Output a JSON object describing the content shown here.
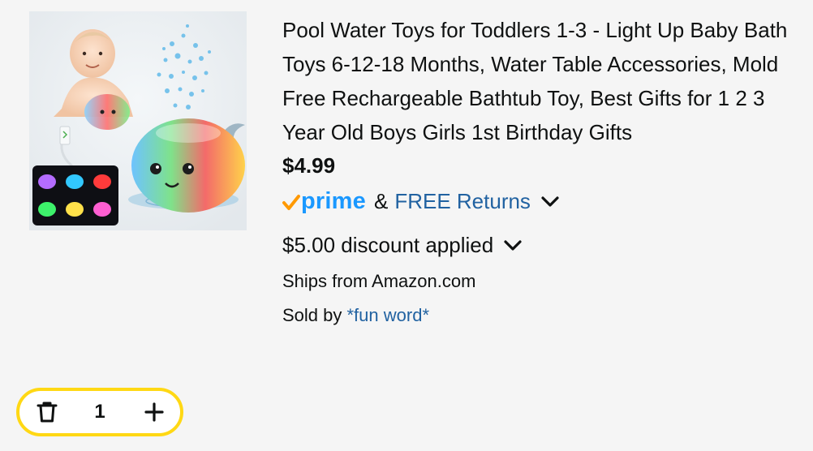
{
  "product": {
    "image_alt": "whale bath toy",
    "title": "Pool Water Toys for Toddlers 1-3 - Light Up Baby Bath Toys 6-12-18 Months, Water Table Accessories, Mold Free Rechargeable Bathtub Toy, Best Gifts for 1 2 3 Year Old Boys Girls 1st Birthday Gifts",
    "price": "$4.99",
    "prime_label": "prime",
    "ampersand": "&",
    "returns_label": "FREE Returns",
    "discount_label": "$5.00 discount applied",
    "ships_from": "Ships from Amazon.com",
    "sold_by_prefix": "Sold by ",
    "seller": "*fun word*"
  },
  "stepper": {
    "quantity": "1"
  },
  "colors": {
    "prime_blue": "#1a98ff",
    "prime_check": "#ff9900",
    "link_blue": "#2162a1",
    "stepper_border": "#ffd814"
  },
  "icons": {
    "trash": "trash-icon",
    "plus": "plus-icon",
    "returns_chevron": "chevron-down-icon",
    "discount_chevron": "chevron-down-icon",
    "prime_check": "check-icon"
  }
}
